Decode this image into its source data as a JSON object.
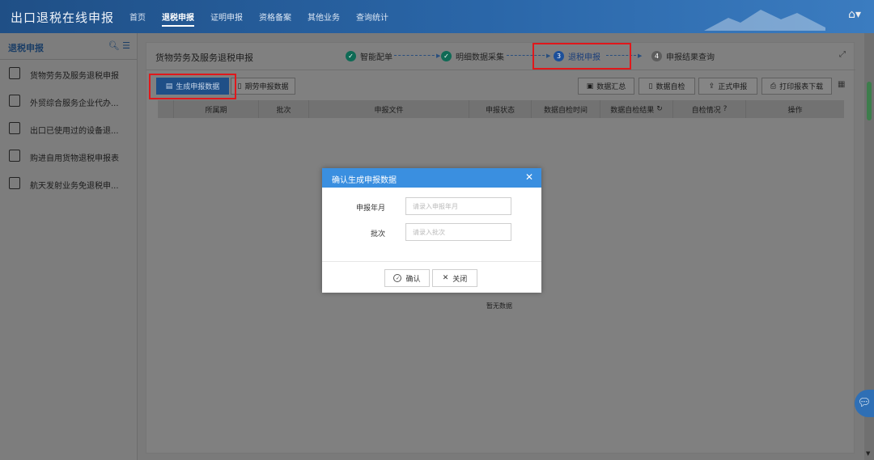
{
  "app": {
    "title": "出口退税在线申报",
    "nav": [
      {
        "label": "首页",
        "active": false
      },
      {
        "label": "退税申报",
        "active": true
      },
      {
        "label": "证明申报",
        "active": false
      },
      {
        "label": "资格备案",
        "active": false
      },
      {
        "label": "其他业务",
        "active": false
      },
      {
        "label": "查询统计",
        "active": false
      }
    ],
    "user_icon": "building-icon"
  },
  "sidebar": {
    "heading": "退税申报",
    "items": [
      {
        "label": "货物劳务及服务退税申报",
        "icon": "goods-icon"
      },
      {
        "label": "外贸综合服务企业代办...",
        "icon": "document-icon"
      },
      {
        "label": "出口已使用过的设备退...",
        "icon": "document-icon"
      },
      {
        "label": "购进自用货物退税申报表",
        "icon": "document-icon"
      },
      {
        "label": "航天发射业务免退税申...",
        "icon": "document-icon"
      }
    ]
  },
  "main": {
    "page_title": "货物劳务及服务退税申报",
    "steps": [
      {
        "num": "✓",
        "label": "智能配单",
        "state": "done"
      },
      {
        "num": "✓",
        "label": "明细数据采集",
        "state": "done"
      },
      {
        "num": "3",
        "label": "退税申报",
        "state": "current"
      },
      {
        "num": "4",
        "label": "申报结果查询",
        "state": "future"
      }
    ],
    "toolbar": {
      "generate": "生成申报数据",
      "other": "期劳申报数据",
      "summary": "数据汇总",
      "selfcheck": "数据自检",
      "formal": "正式申报",
      "print": "打印报表下载"
    },
    "table": {
      "columns": [
        "所属期",
        "批次",
        "申报文件",
        "申报状态",
        "数据自检时间",
        "数据自检结果",
        "自检情况",
        "操作"
      ]
    },
    "empty_text": "暂无数据"
  },
  "modal": {
    "title": "确认生成申报数据",
    "fields": [
      {
        "label": "申报年月",
        "placeholder": "请录入申报年月"
      },
      {
        "label": "批次",
        "placeholder": "请录入批次"
      }
    ],
    "confirm": "确认",
    "close": "关闭"
  },
  "colors": {
    "header_blue": "#1f4f86",
    "modal_header": "#3a8fe0",
    "highlight_red": "#e0181b",
    "step_done": "#0f6a55"
  }
}
